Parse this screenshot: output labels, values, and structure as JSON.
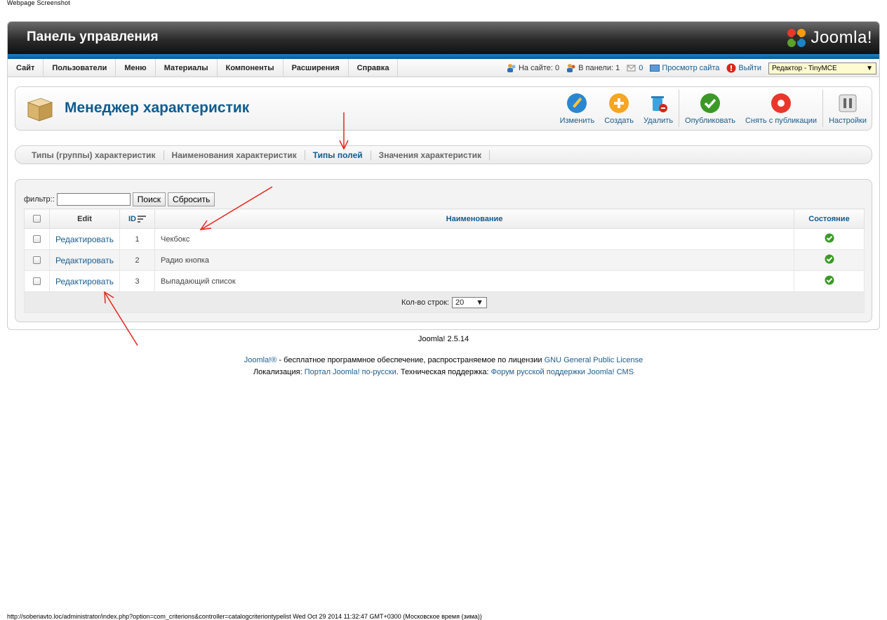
{
  "caption": "Webpage Screenshot",
  "header": {
    "title": "Панель управления",
    "brand": "Joomla!"
  },
  "menu": [
    "Сайт",
    "Пользователи",
    "Меню",
    "Материалы",
    "Компоненты",
    "Расширения",
    "Справка"
  ],
  "status": {
    "online": "На сайте: 0",
    "admins": "В панели: 1",
    "messages": "0",
    "preview": "Просмотр сайта",
    "logout": "Выйти",
    "editor": "Редактор - TinyMCE"
  },
  "toolbar": {
    "title": "Менеджер характеристик",
    "buttons": {
      "edit": "Изменить",
      "create": "Создать",
      "delete": "Удалить",
      "publish": "Опубликовать",
      "unpublish": "Снять с публикации",
      "options": "Настройки"
    }
  },
  "subtabs": {
    "t1": "Типы (группы) характеристик",
    "t2": "Наименования характеристик",
    "t3": "Типы полей",
    "t4": "Значения характеристик"
  },
  "filter": {
    "label": "фильтр::",
    "value": "",
    "search": "Поиск",
    "reset": "Сбросить"
  },
  "table": {
    "headers": {
      "edit": "Edit",
      "id": "ID",
      "name": "Наименование",
      "state": "Состояние"
    },
    "rows": [
      {
        "edit": "Редактировать",
        "id": "1",
        "name": "Чекбокс",
        "published": true
      },
      {
        "edit": "Редактировать",
        "id": "2",
        "name": "Радио кнопка",
        "published": true
      },
      {
        "edit": "Редактировать",
        "id": "3",
        "name": "Выпадающий список",
        "published": true
      }
    ],
    "limit_label": "Кол-во строк:",
    "limit_value": "20"
  },
  "footer": {
    "version": "Joomla! 2.5.14",
    "line1_link1": "Joomla!®",
    "line1_text": " - бесплатное программное обеспечение, распространяемое по лицензии ",
    "line1_link2": "GNU General Public License",
    "line2_text1": "Локализация: ",
    "line2_link1": "Портал Joomla! по-русски",
    "line2_text2": ". Техническая поддержка: ",
    "line2_link2": "Форум русской поддержки Joomla! CMS"
  },
  "url_bar": "http://soberiavto.loc/administrator/index.php?option=com_criterions&controller=catalogcriteriontypelist Wed Oct 29 2014 11:32:47 GMT+0300 (Московское время (зима))",
  "colors": {
    "accent": "#0d5c8f",
    "link": "#1a5c8c",
    "header_stripe": "#1f7fc0",
    "publish_green": "#3a9a25",
    "annotation_red": "#e8231b"
  }
}
